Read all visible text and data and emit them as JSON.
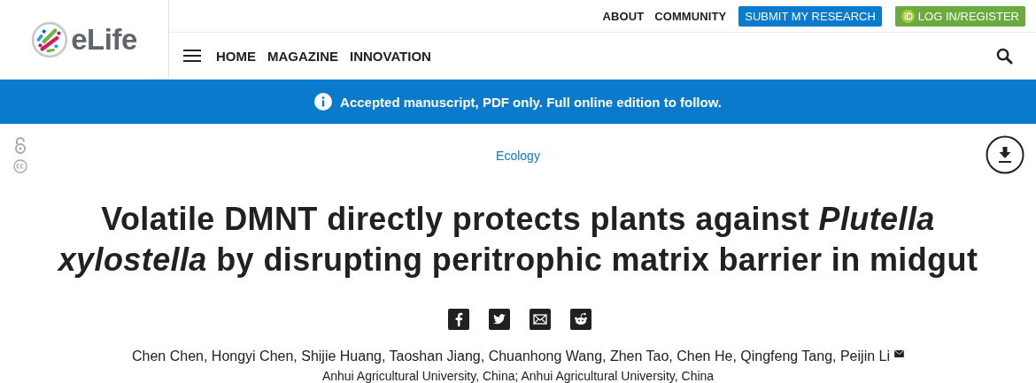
{
  "logo": {
    "text": "eLife"
  },
  "top_links": [
    {
      "label": "ABOUT",
      "kind": "link"
    },
    {
      "label": "COMMUNITY",
      "kind": "link"
    },
    {
      "label": "SUBMIT MY RESEARCH",
      "kind": "primary"
    },
    {
      "label": "LOG IN/REGISTER",
      "kind": "login"
    }
  ],
  "nav": [
    "HOME",
    "MAGAZINE",
    "INNOVATION"
  ],
  "banner": "Accepted manuscript, PDF only. Full online edition to follow.",
  "subject": "Ecology",
  "title": "Volatile DMNT directly protects plants against *Plutella xylostella* by disrupting peritrophic matrix barrier in midgut",
  "share": [
    {
      "kind": "facebook"
    },
    {
      "kind": "twitter"
    },
    {
      "kind": "email"
    },
    {
      "kind": "reddit"
    }
  ],
  "authors": "Chen Chen, Hongyi Chen, Shijie Huang, Taoshan Jiang, Chuanhong Wang, Zhen Tao, Chen He, Qingfeng Tang, Peijin Li",
  "affiliation": "Anhui Agricultural University, China; Anhui Agricultural University, China"
}
